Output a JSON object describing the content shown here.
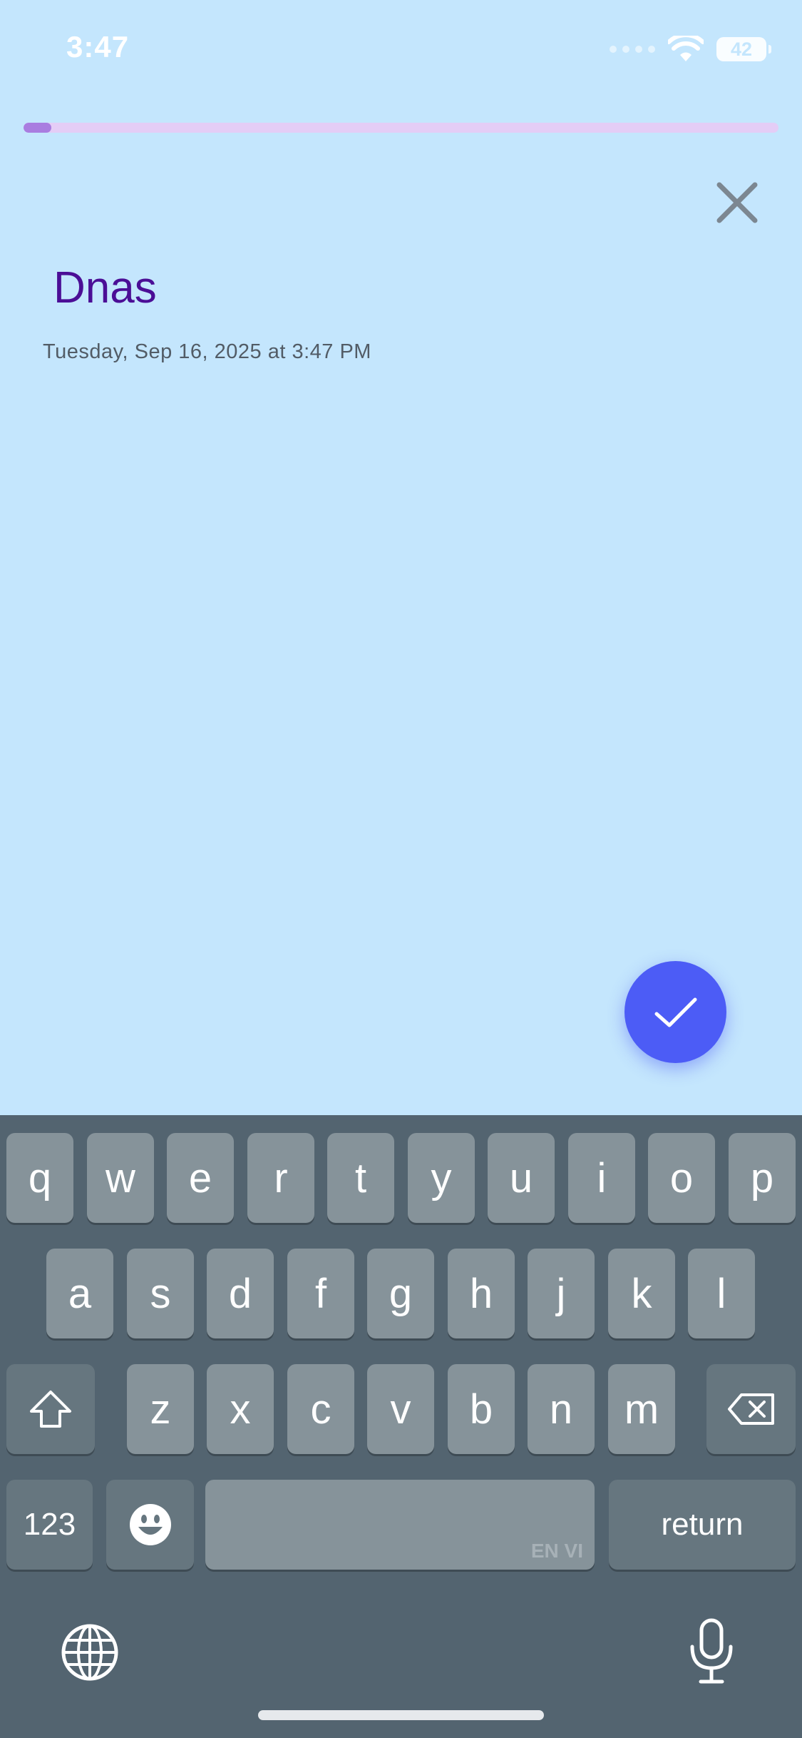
{
  "status_bar": {
    "time": "3:47",
    "battery": "42"
  },
  "progress": {
    "value": 0.037,
    "track_color": "#e4cdf6",
    "fill_color": "#a97de0"
  },
  "note": {
    "title": "Dnas",
    "timestamp": "Tuesday, Sep 16, 2025 at 3:47 PM"
  },
  "icons": {
    "close": "close-icon",
    "confirm": "checkmark-icon"
  },
  "keyboard": {
    "row1": [
      "q",
      "w",
      "e",
      "r",
      "t",
      "y",
      "u",
      "i",
      "o",
      "p"
    ],
    "row2": [
      "a",
      "s",
      "d",
      "f",
      "g",
      "h",
      "j",
      "k",
      "l"
    ],
    "row3": [
      "z",
      "x",
      "c",
      "v",
      "b",
      "n",
      "m"
    ],
    "numbers_label": "123",
    "return_label": "return",
    "language_tag": "EN VI"
  }
}
